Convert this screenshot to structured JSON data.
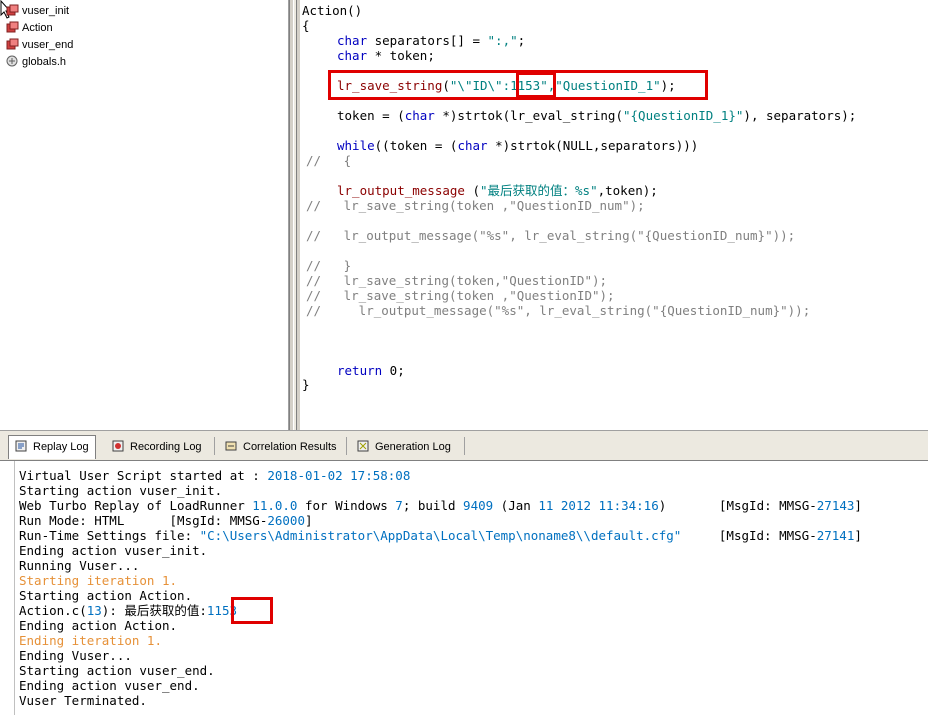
{
  "tree": {
    "items": [
      {
        "label": "vuser_init",
        "icon": "script-file-icon"
      },
      {
        "label": "Action",
        "icon": "script-file-icon"
      },
      {
        "label": "vuser_end",
        "icon": "script-file-icon"
      },
      {
        "label": "globals.h",
        "icon": "header-file-icon"
      }
    ]
  },
  "code": {
    "l1": "Action()",
    "l2": "{",
    "l3a": "char",
    "l3b": " separators[] = ",
    "l3c": "\":,\"",
    "l3d": ";",
    "l4a": "char",
    "l4b": " * token;",
    "l5a": "lr_save_string",
    "l5b": "(",
    "l5c": "\"\\\"ID\\\":",
    "l5d": "1153",
    "l5e": "\",\"QuestionID_1\"",
    "l5f": ");",
    "l6a": "token = (",
    "l6b": "char",
    "l6c": " *)strtok(lr_eval_string(",
    "l6d": "\"{QuestionID_1}\"",
    "l6e": "), separators);",
    "l7a": "while",
    "l7b": "((token = (",
    "l7c": "char",
    "l7d": " *)strtok(NULL,separators)))",
    "l8": "//   {",
    "l9a": "lr_output_message",
    "l9b": " (",
    "l9c": "\"最后获取的值：%s\"",
    "l9d": ",token);",
    "l10": "//   lr_save_string(token ,\"QuestionID_num\");",
    "l11": "//   lr_output_message(\"%s\", lr_eval_string(\"{QuestionID_num}\"));",
    "l12": "//   }",
    "l13": "//   lr_save_string(token,\"QuestionID\");",
    "l14": "//   lr_save_string(token ,\"QuestionID\");",
    "l15": "//     lr_output_message(\"%s\", lr_eval_string(\"{QuestionID_num}\"));",
    "l16a": "return",
    "l16b": " 0;",
    "l17": "}"
  },
  "tabs": [
    {
      "label": "Replay Log",
      "icon": "replay-log-icon",
      "active": true
    },
    {
      "label": "Recording Log",
      "icon": "recording-log-icon",
      "active": false
    },
    {
      "label": "Correlation Results",
      "icon": "correlation-icon",
      "active": false
    },
    {
      "label": "Generation Log",
      "icon": "generation-log-icon",
      "active": false
    }
  ],
  "log": {
    "l1a": "Virtual User Script started at : ",
    "l1b": "2018-01-02 17:58:08",
    "l2": "Starting action vuser_init.",
    "l3a": "Web Turbo Replay of LoadRunner ",
    "l3b": "11.0.0",
    "l3c": " for Windows ",
    "l3d": "7",
    "l3e": "; build ",
    "l3f": "9409",
    "l3g": " (Jan ",
    "l3h": "11 2012 11:34:16",
    "l3i": ")       [MsgId: MMSG-",
    "l3j": "27143",
    "l3k": "]",
    "l4a": "Run Mode: HTML      [MsgId: MMSG-",
    "l4b": "26000",
    "l4c": "]",
    "l5a": "Run-Time Settings file: ",
    "l5b": "\"C:\\Users\\Administrator\\AppData\\Local\\Temp\\noname8\\\\default.cfg\"",
    "l5c": "     [MsgId: MMSG-",
    "l5d": "27141",
    "l5e": "]",
    "l6": "Ending action vuser_init.",
    "l7": "Running Vuser...",
    "l8": "Starting iteration 1.",
    "l9": "Starting action Action.",
    "l10a": "Action.c(",
    "l10b": "13",
    "l10c": "): 最后获取的值:",
    "l10d": "1153",
    "l11": "Ending action Action.",
    "l12": "Ending iteration 1.",
    "l13": "Ending Vuser...",
    "l14": "Starting action vuser_end.",
    "l15": "Ending action vuser_end.",
    "l16": "Vuser Terminated."
  }
}
